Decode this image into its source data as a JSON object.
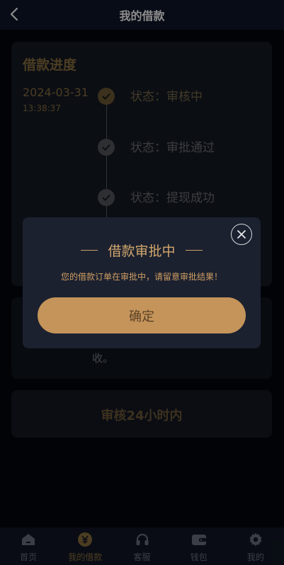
{
  "header": {
    "title": "我的借款"
  },
  "progress": {
    "title": "借款进度",
    "date": "2024-03-31",
    "time": "13:38:37",
    "steps": [
      {
        "label": "状态：审核中",
        "state": "done"
      },
      {
        "label": "状态：审批通过",
        "state": "pending"
      },
      {
        "label": "状态：提现成功",
        "state": "pending"
      }
    ]
  },
  "notice": {
    "tail": "收。"
  },
  "review": {
    "text": "审核24小时内"
  },
  "modal": {
    "title": "借款审批中",
    "message": "您的借款订单在审批中，请留意审批结果！",
    "confirm_label": "确定"
  },
  "tabbar": {
    "items": [
      {
        "label": "首页",
        "icon": "home-icon"
      },
      {
        "label": "我的借款",
        "icon": "yuan-icon",
        "active": true
      },
      {
        "label": "客服",
        "icon": "headset-icon"
      },
      {
        "label": "钱包",
        "icon": "wallet-icon"
      },
      {
        "label": "我的",
        "icon": "gear-icon"
      }
    ]
  },
  "colors": {
    "accent": "#c4945a",
    "header_bg": "#0f1628",
    "modal_bg": "#1c2130"
  }
}
